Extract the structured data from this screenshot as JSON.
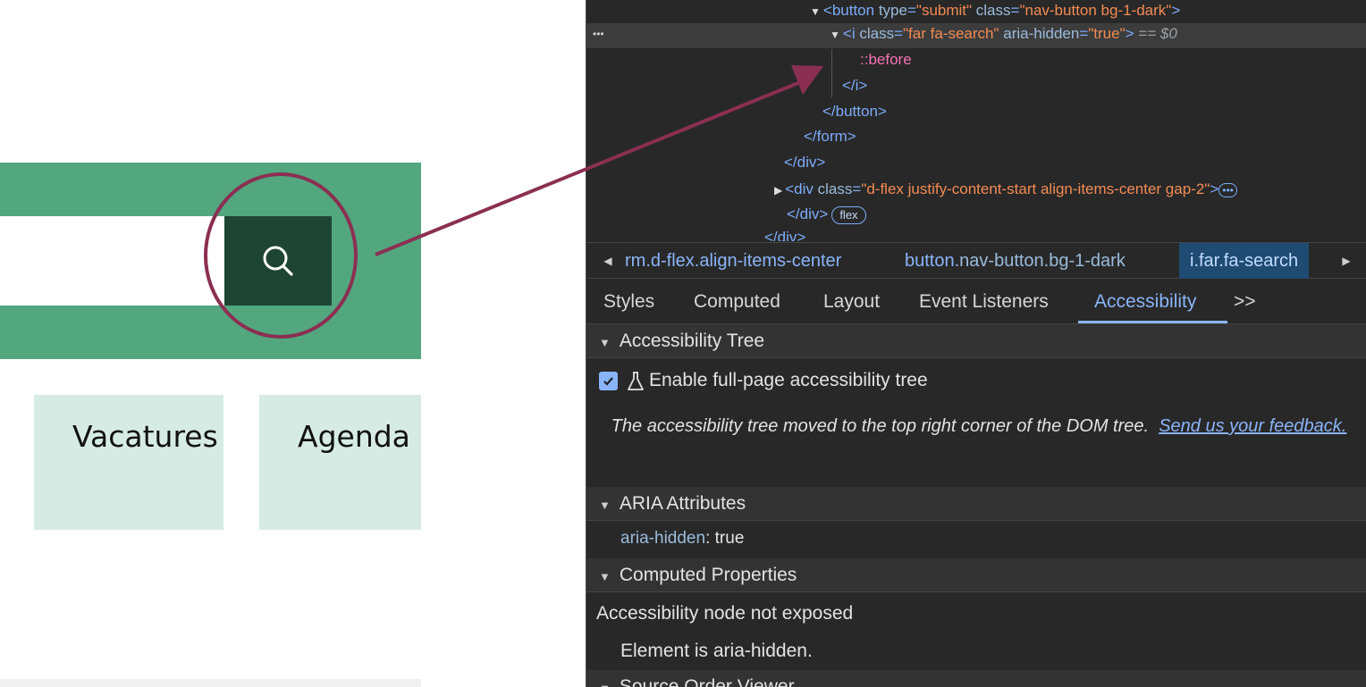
{
  "page": {
    "tiles": [
      {
        "label": "Vacatures"
      },
      {
        "label": "Agenda"
      }
    ],
    "colors": {
      "band": "#52a77f",
      "button": "#1e4534",
      "tile": "#d6ebe3",
      "annotation": "#8b2f52"
    },
    "search_button_icon": "search-icon"
  },
  "devtools": {
    "dom_lines": [
      {
        "pre": "<",
        "tag": "button",
        "attrs": [
          {
            "n": "type",
            "v": "\"submit\""
          },
          {
            "n": "class",
            "v": "\"nav-button bg-1-dark\""
          }
        ],
        "post": ">"
      },
      {
        "pre": "<",
        "tag": "i",
        "attrs": [
          {
            "n": "class",
            "v": "\"far fa-search\""
          },
          {
            "n": "aria-hidden",
            "v": "\"true\""
          }
        ],
        "post": ">",
        "suffix": "== $0"
      },
      {
        "text": "::before"
      },
      {
        "text": "</i>"
      },
      {
        "text": "</button>"
      },
      {
        "text": "</form>"
      },
      {
        "text": "</div>"
      },
      {
        "pre": "<",
        "tag": "div",
        "attrs": [
          {
            "n": "class",
            "v": "\"d-flex justify-content-start align-items-center gap-2\""
          }
        ],
        "post": ">"
      },
      {
        "text": "</div>",
        "badge": "flex"
      },
      {
        "text": "</div>"
      }
    ],
    "row_menu": "•••",
    "ellipsis": "•••",
    "breadcrumbs": [
      {
        "text": "rm.d-flex.align-items-center"
      },
      {
        "tag": "button",
        "rest": ".nav-button.bg-1-dark"
      },
      {
        "text": "i.far.fa-search"
      }
    ],
    "tabs": [
      "Styles",
      "Computed",
      "Layout",
      "Event Listeners",
      "Accessibility"
    ],
    "tabs_more": ">>",
    "sections": {
      "tree_title": "Accessibility Tree",
      "enable_label": "Enable full-page accessibility tree",
      "note_text": "The accessibility tree moved to the top right corner of the DOM tree.",
      "note_link": "Send us your feedback.",
      "aria_title": "ARIA Attributes",
      "aria_name": "aria-hidden",
      "aria_value": "true",
      "computed_title": "Computed Properties",
      "not_exposed": "Accessibility node not exposed",
      "hidden_reason": "Element is aria-hidden.",
      "source_order_title": "Source Order Viewer"
    }
  }
}
